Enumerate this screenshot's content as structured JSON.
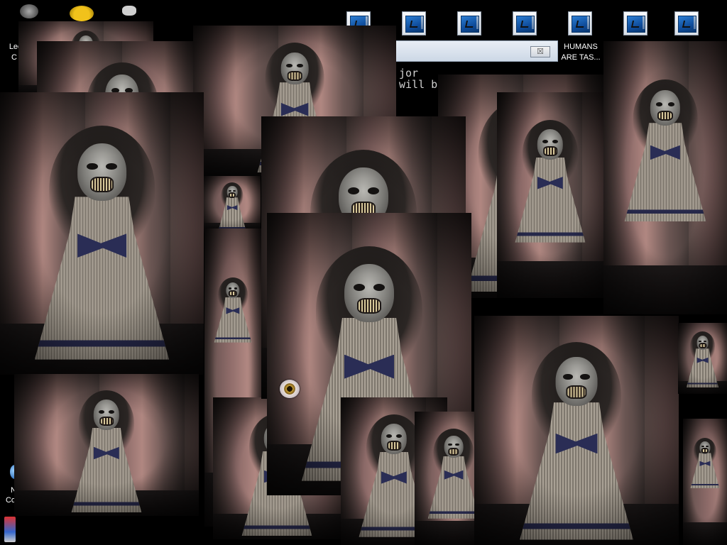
{
  "desktop": {
    "top_icons": [
      {
        "name": "shortcut-icon-1",
        "label": ""
      },
      {
        "name": "shortcut-icon-2",
        "label": ""
      },
      {
        "name": "shortcut-icon-3",
        "label": ""
      },
      {
        "name": "shortcut-icon-4",
        "label": ""
      },
      {
        "name": "shortcut-icon-5",
        "label": "HUMANS ARE TAS..."
      },
      {
        "name": "shortcut-icon-6",
        "label": ""
      },
      {
        "name": "shortcut-icon-7",
        "label": ""
      }
    ],
    "left_labels": {
      "top": "Lee",
      "top2": "C",
      "bottom": "N",
      "bottom2": "Co"
    },
    "humans_label_line1": "HUMANS",
    "humans_label_line2": "ARE TAS..."
  },
  "background_window": {
    "close_glyph": "☒",
    "console_line1": "jor",
    "console_line2": "will b"
  },
  "popups": {
    "image_description": "doll",
    "count": 14
  },
  "colors": {
    "desktop_bg": "#000000",
    "window_title": "#dbe3ee",
    "console_bg": "#000000",
    "console_text": "#d0d0d0"
  }
}
